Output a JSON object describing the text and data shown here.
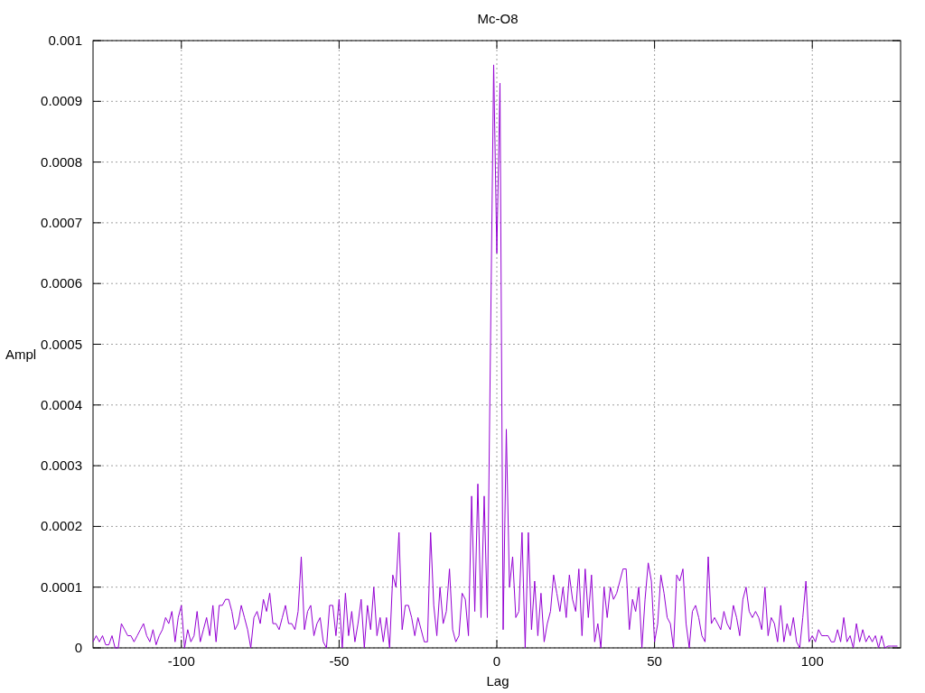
{
  "chart_data": {
    "type": "line",
    "grid": true,
    "title": "Mc-O8",
    "xlabel": "Lag",
    "ylabel": "Ampl",
    "xlim": [
      -128,
      128
    ],
    "ylim": [
      0,
      0.001
    ],
    "xticks": [
      -100,
      -50,
      0,
      50,
      100
    ],
    "yticks": [
      {
        "value": 0,
        "label": "0"
      },
      {
        "value": 0.0001,
        "label": "0.0001"
      },
      {
        "value": 0.0002,
        "label": "0.0002"
      },
      {
        "value": 0.0003,
        "label": "0.0003"
      },
      {
        "value": 0.0004,
        "label": "0.0004"
      },
      {
        "value": 0.0005,
        "label": "0.0005"
      },
      {
        "value": 0.0006,
        "label": "0.0006"
      },
      {
        "value": 0.0007,
        "label": "0.0007"
      },
      {
        "value": 0.0008,
        "label": "0.0008"
      },
      {
        "value": 0.0009,
        "label": "0.0009"
      },
      {
        "value": 0.001,
        "label": "0.001"
      }
    ],
    "x": [
      -128,
      -127,
      -126,
      -125,
      -124,
      -123,
      -122,
      -121,
      -120,
      -119,
      -118,
      -117,
      -116,
      -115,
      -114,
      -113,
      -112,
      -111,
      -110,
      -109,
      -108,
      -107,
      -106,
      -105,
      -104,
      -103,
      -102,
      -101,
      -100,
      -99,
      -98,
      -97,
      -96,
      -95,
      -94,
      -93,
      -92,
      -91,
      -90,
      -89,
      -88,
      -87,
      -86,
      -85,
      -84,
      -83,
      -82,
      -81,
      -80,
      -79,
      -78,
      -77,
      -76,
      -75,
      -74,
      -73,
      -72,
      -71,
      -70,
      -69,
      -68,
      -67,
      -66,
      -65,
      -64,
      -63,
      -62,
      -61,
      -60,
      -59,
      -58,
      -57,
      -56,
      -55,
      -54,
      -53,
      -52,
      -51,
      -50,
      -49,
      -48,
      -47,
      -46,
      -45,
      -44,
      -43,
      -42,
      -41,
      -40,
      -39,
      -38,
      -37,
      -36,
      -35,
      -34,
      -33,
      -32,
      -31,
      -30,
      -29,
      -28,
      -27,
      -26,
      -25,
      -24,
      -23,
      -22,
      -21,
      -20,
      -19,
      -18,
      -17,
      -16,
      -15,
      -14,
      -13,
      -12,
      -11,
      -10,
      -9,
      -8,
      -7,
      -6,
      -5,
      -4,
      -3,
      -2,
      -1,
      0,
      1,
      2,
      3,
      4,
      5,
      6,
      7,
      8,
      9,
      10,
      11,
      12,
      13,
      14,
      15,
      16,
      17,
      18,
      19,
      20,
      21,
      22,
      23,
      24,
      25,
      26,
      27,
      28,
      29,
      30,
      31,
      32,
      33,
      34,
      35,
      36,
      37,
      38,
      39,
      40,
      41,
      42,
      43,
      44,
      45,
      46,
      47,
      48,
      49,
      50,
      51,
      52,
      53,
      54,
      55,
      56,
      57,
      58,
      59,
      60,
      61,
      62,
      63,
      64,
      65,
      66,
      67,
      68,
      69,
      70,
      71,
      72,
      73,
      74,
      75,
      76,
      77,
      78,
      79,
      80,
      81,
      82,
      83,
      84,
      85,
      86,
      87,
      88,
      89,
      90,
      91,
      92,
      93,
      94,
      95,
      96,
      97,
      98,
      99,
      100,
      101,
      102,
      103,
      104,
      105,
      106,
      107,
      108,
      109,
      110,
      111,
      112,
      113,
      114,
      115,
      116,
      117,
      118,
      119,
      120,
      121,
      122,
      123,
      124,
      125,
      126,
      127
    ],
    "series": [
      {
        "color": "#9400d3",
        "values": [
          1e-05,
          2e-05,
          1e-05,
          2e-05,
          5e-06,
          5e-06,
          2e-05,
          0,
          0,
          4e-05,
          3e-05,
          2e-05,
          2e-05,
          1e-05,
          2e-05,
          3e-05,
          4e-05,
          2e-05,
          1e-05,
          3e-05,
          5e-06,
          2e-05,
          3e-05,
          5e-05,
          4e-05,
          6e-05,
          1e-05,
          5e-05,
          7e-05,
          0,
          3e-05,
          1e-05,
          2e-05,
          6e-05,
          1e-05,
          3e-05,
          5e-05,
          2e-05,
          7e-05,
          1e-05,
          7e-05,
          7e-05,
          8e-05,
          8e-05,
          6e-05,
          3e-05,
          4e-05,
          7e-05,
          5e-05,
          3e-05,
          0,
          5e-05,
          6e-05,
          4e-05,
          8e-05,
          6e-05,
          9e-05,
          4e-05,
          4e-05,
          3e-05,
          5e-05,
          7e-05,
          4e-05,
          4e-05,
          3e-05,
          6e-05,
          0.00015,
          3e-05,
          6e-05,
          7e-05,
          2e-05,
          4e-05,
          5e-05,
          1e-05,
          0,
          7e-05,
          7e-05,
          2e-05,
          8e-05,
          0,
          9e-05,
          2e-05,
          6e-05,
          1e-05,
          4e-05,
          8e-05,
          0,
          7e-05,
          3e-05,
          0.0001,
          2e-05,
          5e-05,
          1e-05,
          5e-05,
          0,
          0.00012,
          0.0001,
          0.00019,
          3e-05,
          7e-05,
          7e-05,
          5e-05,
          2e-05,
          5e-05,
          3e-05,
          1e-05,
          1e-05,
          0.00019,
          7e-05,
          2e-05,
          0.0001,
          4e-05,
          6e-05,
          0.00013,
          3e-05,
          1e-05,
          2e-05,
          9e-05,
          8e-05,
          2e-05,
          0.00025,
          6e-05,
          0.00027,
          5e-05,
          0.00025,
          5e-05,
          0.0005,
          0.00096,
          0.00065,
          0.00093,
          3e-05,
          0.00036,
          0.0001,
          0.00015,
          5e-05,
          6e-05,
          0.00019,
          0,
          0.00019,
          3e-05,
          0.00011,
          2e-05,
          9e-05,
          1e-05,
          4e-05,
          6e-05,
          0.00012,
          9e-05,
          6e-05,
          0.0001,
          5e-05,
          0.00012,
          8e-05,
          6e-05,
          0.00013,
          2e-05,
          0.00013,
          5e-05,
          0.00012,
          1e-05,
          4e-05,
          0,
          0.0001,
          5e-05,
          0.0001,
          8e-05,
          9e-05,
          0.00011,
          0.00013,
          0.00013,
          3e-05,
          8e-05,
          6e-05,
          0.0001,
          0,
          8e-05,
          0.00014,
          0.00011,
          1e-05,
          4e-05,
          0.00012,
          9e-05,
          5e-05,
          4e-05,
          0,
          0.00012,
          0.00011,
          0.00013,
          4e-05,
          0,
          6e-05,
          7e-05,
          5e-05,
          2e-05,
          1e-05,
          0.00015,
          4e-05,
          5e-05,
          4e-05,
          3e-05,
          6e-05,
          4e-05,
          3e-05,
          7e-05,
          5e-05,
          2e-05,
          8e-05,
          0.0001,
          6e-05,
          5e-05,
          6e-05,
          5e-05,
          3e-05,
          0.0001,
          2e-05,
          5e-05,
          4e-05,
          1e-05,
          7e-05,
          1e-05,
          4e-05,
          2e-05,
          5e-05,
          1e-05,
          0,
          5e-05,
          0.00011,
          1e-05,
          2e-05,
          1e-05,
          3e-05,
          2e-05,
          2e-05,
          2e-05,
          1e-05,
          1e-05,
          3e-05,
          1e-05,
          5e-05,
          1e-05,
          2e-05,
          0,
          4e-05,
          1e-05,
          3e-05,
          1e-05,
          2e-05,
          1e-05,
          2e-05,
          0,
          2e-05,
          0,
          3e-06,
          3e-06,
          3e-06,
          3e-06
        ]
      }
    ]
  }
}
